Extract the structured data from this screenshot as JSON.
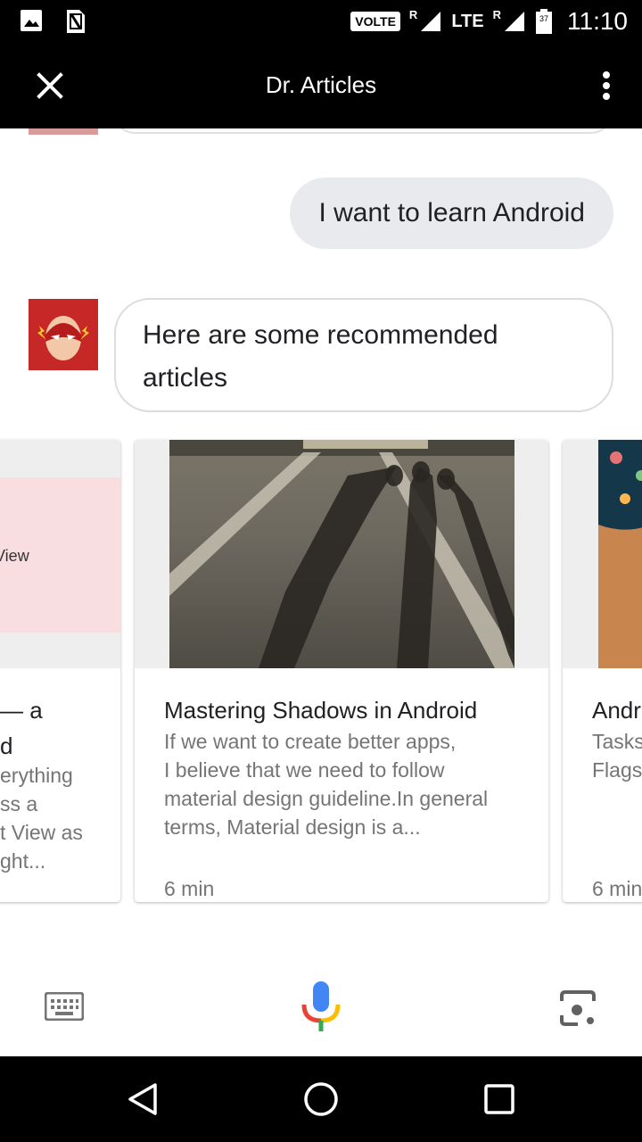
{
  "status_bar": {
    "volte": "VOLTE",
    "roaming_1": "R",
    "lte": "LTE",
    "roaming_2": "R",
    "battery": "37",
    "time": "11:10"
  },
  "app_bar": {
    "title": "Dr. Articles"
  },
  "chat": {
    "user_message": "I want to learn Android",
    "bot_message": "Here are some recommended articles"
  },
  "cards": [
    {
      "image_text": "View",
      "title_lines": [
        "— a",
        "d"
      ],
      "desc_lines": [
        "erything",
        "ss a",
        "t View as",
        "ght..."
      ]
    },
    {
      "title": "Mastering Shadows in Android",
      "desc_lines": [
        "If we want to create better apps,",
        "I believe that we need to follow",
        "material design guideline.In general",
        "terms, Material design is a..."
      ],
      "time": "6 min"
    },
    {
      "title": "Andr",
      "desc_lines": [
        "Tasks",
        "Flags"
      ],
      "time": "6 min"
    }
  ],
  "colors": {
    "bar_bg": "#000000",
    "user_bubble": "#e8eaed",
    "bot_bubble_border": "#dadce0",
    "avatar_red": "#c62828",
    "mic_blue": "#4285f4",
    "mic_red": "#ea4335",
    "mic_yellow": "#fbbc05",
    "mic_green": "#34a853"
  }
}
